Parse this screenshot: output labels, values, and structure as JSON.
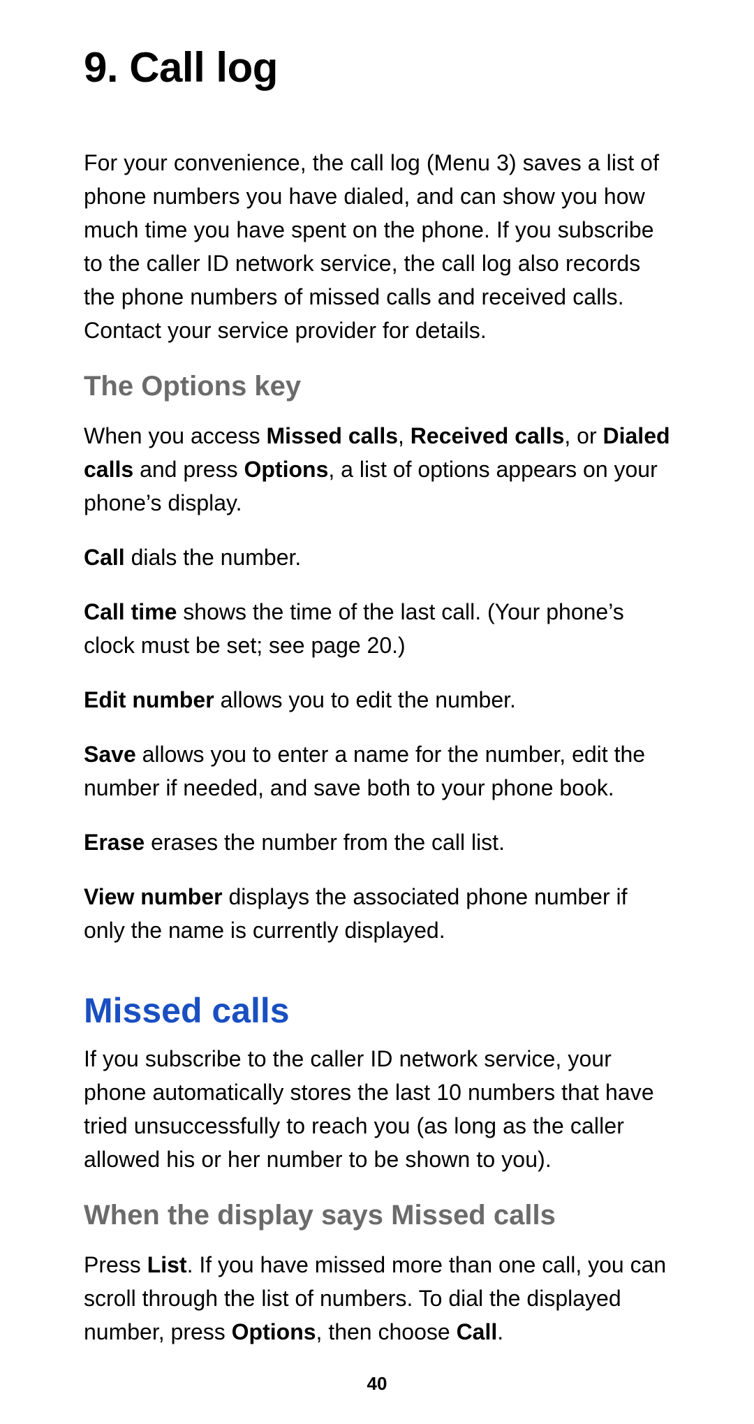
{
  "chapter": {
    "title": "9. Call log",
    "intro": "For your convenience, the call log (Menu 3) saves a list of phone numbers you have dialed, and can show you how much time you have spent on the phone. If you subscribe to the caller ID network service, the call log also records the phone numbers of missed calls and received calls. Contact your service provider for details."
  },
  "options_key": {
    "heading": "The Options key",
    "intro_pre": "When you access ",
    "intro_b1": "Missed calls",
    "intro_sep1": ", ",
    "intro_b2": "Received calls",
    "intro_sep2": ", or ",
    "intro_b3": "Dialed calls",
    "intro_mid": " and press ",
    "intro_b4": "Options",
    "intro_post": ", a list of options appears on your phone’s display.",
    "call_b": "Call",
    "call_t": " dials the number.",
    "calltime_b": "Call time",
    "calltime_t": " shows the time of the last call. (Your phone’s clock must be set; see page 20.)",
    "edit_b": "Edit number",
    "edit_t": " allows you to edit the number.",
    "save_b": "Save",
    "save_t": " allows you to enter a name for the number, edit the number if needed, and save both to your phone book.",
    "erase_b": "Erase",
    "erase_t": " erases the number from the call list.",
    "view_b": "View number",
    "view_t": " displays the associated phone number if only the name is currently displayed."
  },
  "missed": {
    "heading": "Missed calls",
    "intro": "If you subscribe to the caller ID network service, your phone automatically stores the last 10 numbers that have tried unsuccessfully to reach you (as long as the caller allowed his or her number to be shown to you).",
    "sub": "When the display says Missed calls",
    "p_pre": "Press ",
    "p_b1": "List",
    "p_mid": ". If you have missed more than one call, you can scroll through the list of numbers. To dial the displayed number, press ",
    "p_b2": "Options",
    "p_mid2": ", then choose ",
    "p_b3": "Call",
    "p_post": "."
  },
  "page_number": "40"
}
